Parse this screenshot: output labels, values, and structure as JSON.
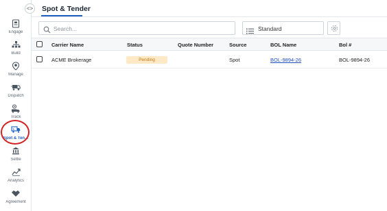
{
  "app": {
    "page_title": "Spot & Tender",
    "collapse_toggle": "<>"
  },
  "sidebar": {
    "items": [
      {
        "label": "Engage",
        "icon": "engage-icon"
      },
      {
        "label": "Build",
        "icon": "build-icon"
      },
      {
        "label": "Manage",
        "icon": "manage-icon"
      },
      {
        "label": "Dispatch",
        "icon": "dispatch-icon"
      },
      {
        "label": "Track",
        "icon": "track-icon"
      },
      {
        "label": "Spot & Ten...",
        "icon": "spot-tender-icon",
        "active": true
      },
      {
        "label": "Settle",
        "icon": "settle-icon"
      },
      {
        "label": "Analytics",
        "icon": "analytics-icon"
      },
      {
        "label": "Agreement",
        "icon": "agreement-icon"
      }
    ]
  },
  "toolbar": {
    "search_placeholder": "Search...",
    "view_value": "Standard"
  },
  "table": {
    "columns": [
      "Carrier Name",
      "Status",
      "Quote Number",
      "Source",
      "BOL Name",
      "Bol #"
    ],
    "rows": [
      {
        "carrier_name": "ACME Brokerage",
        "status": "Pending",
        "quote_number": "",
        "source": "Spot",
        "bol_name": "BOL-9894-26",
        "bol_number": "BOL-9894-26"
      }
    ]
  },
  "colors": {
    "accent": "#1f5fbf",
    "status_pending_bg": "#fde9c6",
    "status_pending_text": "#c07a12",
    "highlight_ring": "#d42020"
  }
}
